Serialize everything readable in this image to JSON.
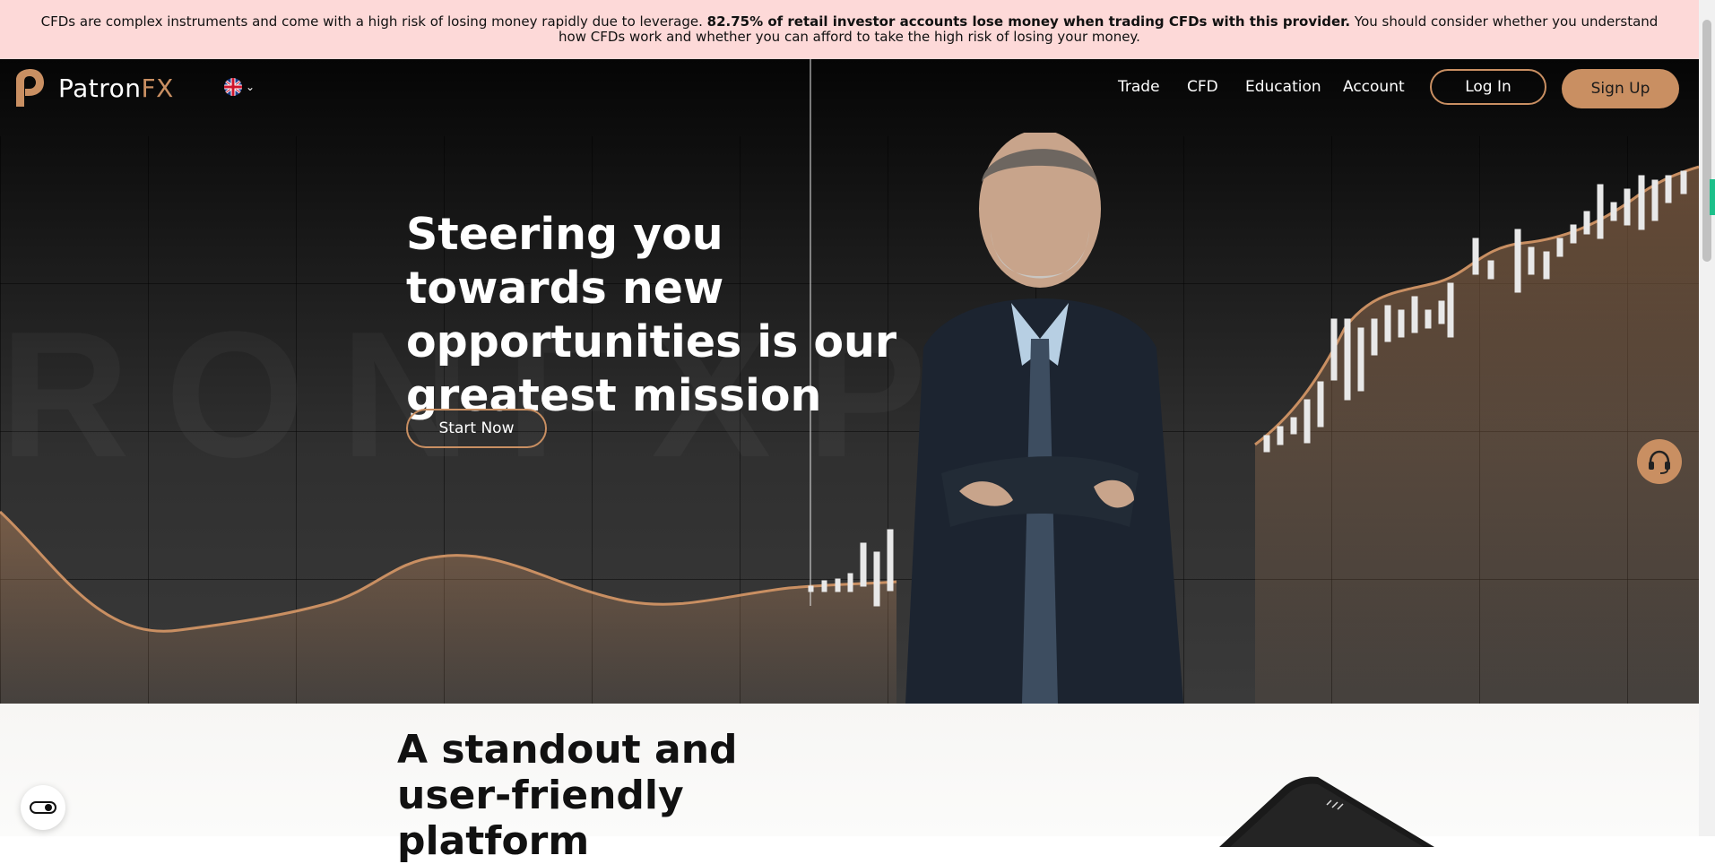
{
  "risk_banner": {
    "text_before": "CFDs are complex instruments and come with a high risk of losing money rapidly due to leverage. ",
    "bold": "82.75% of retail investor accounts lose money when trading CFDs with this provider.",
    "text_after": " You should consider whether you understand how CFDs work and whether you can afford to take the high risk of losing your money."
  },
  "nav": {
    "logo_text_main": "Patron",
    "logo_text_accent": "FX",
    "language": "uk-flag-icon",
    "menu": [
      "Trade",
      "CFD",
      "Education",
      "Account"
    ],
    "login_label": "Log In",
    "signup_label": "Sign Up"
  },
  "hero": {
    "headline": "Steering you towards new opportunities is our greatest mission",
    "cta_label": "Start Now"
  },
  "section2": {
    "heading": "A standout and user-friendly platform"
  },
  "colors": {
    "accent": "#c98f62",
    "banner_bg": "#fdd9d8",
    "hero_dark": "#0a0a0a"
  }
}
